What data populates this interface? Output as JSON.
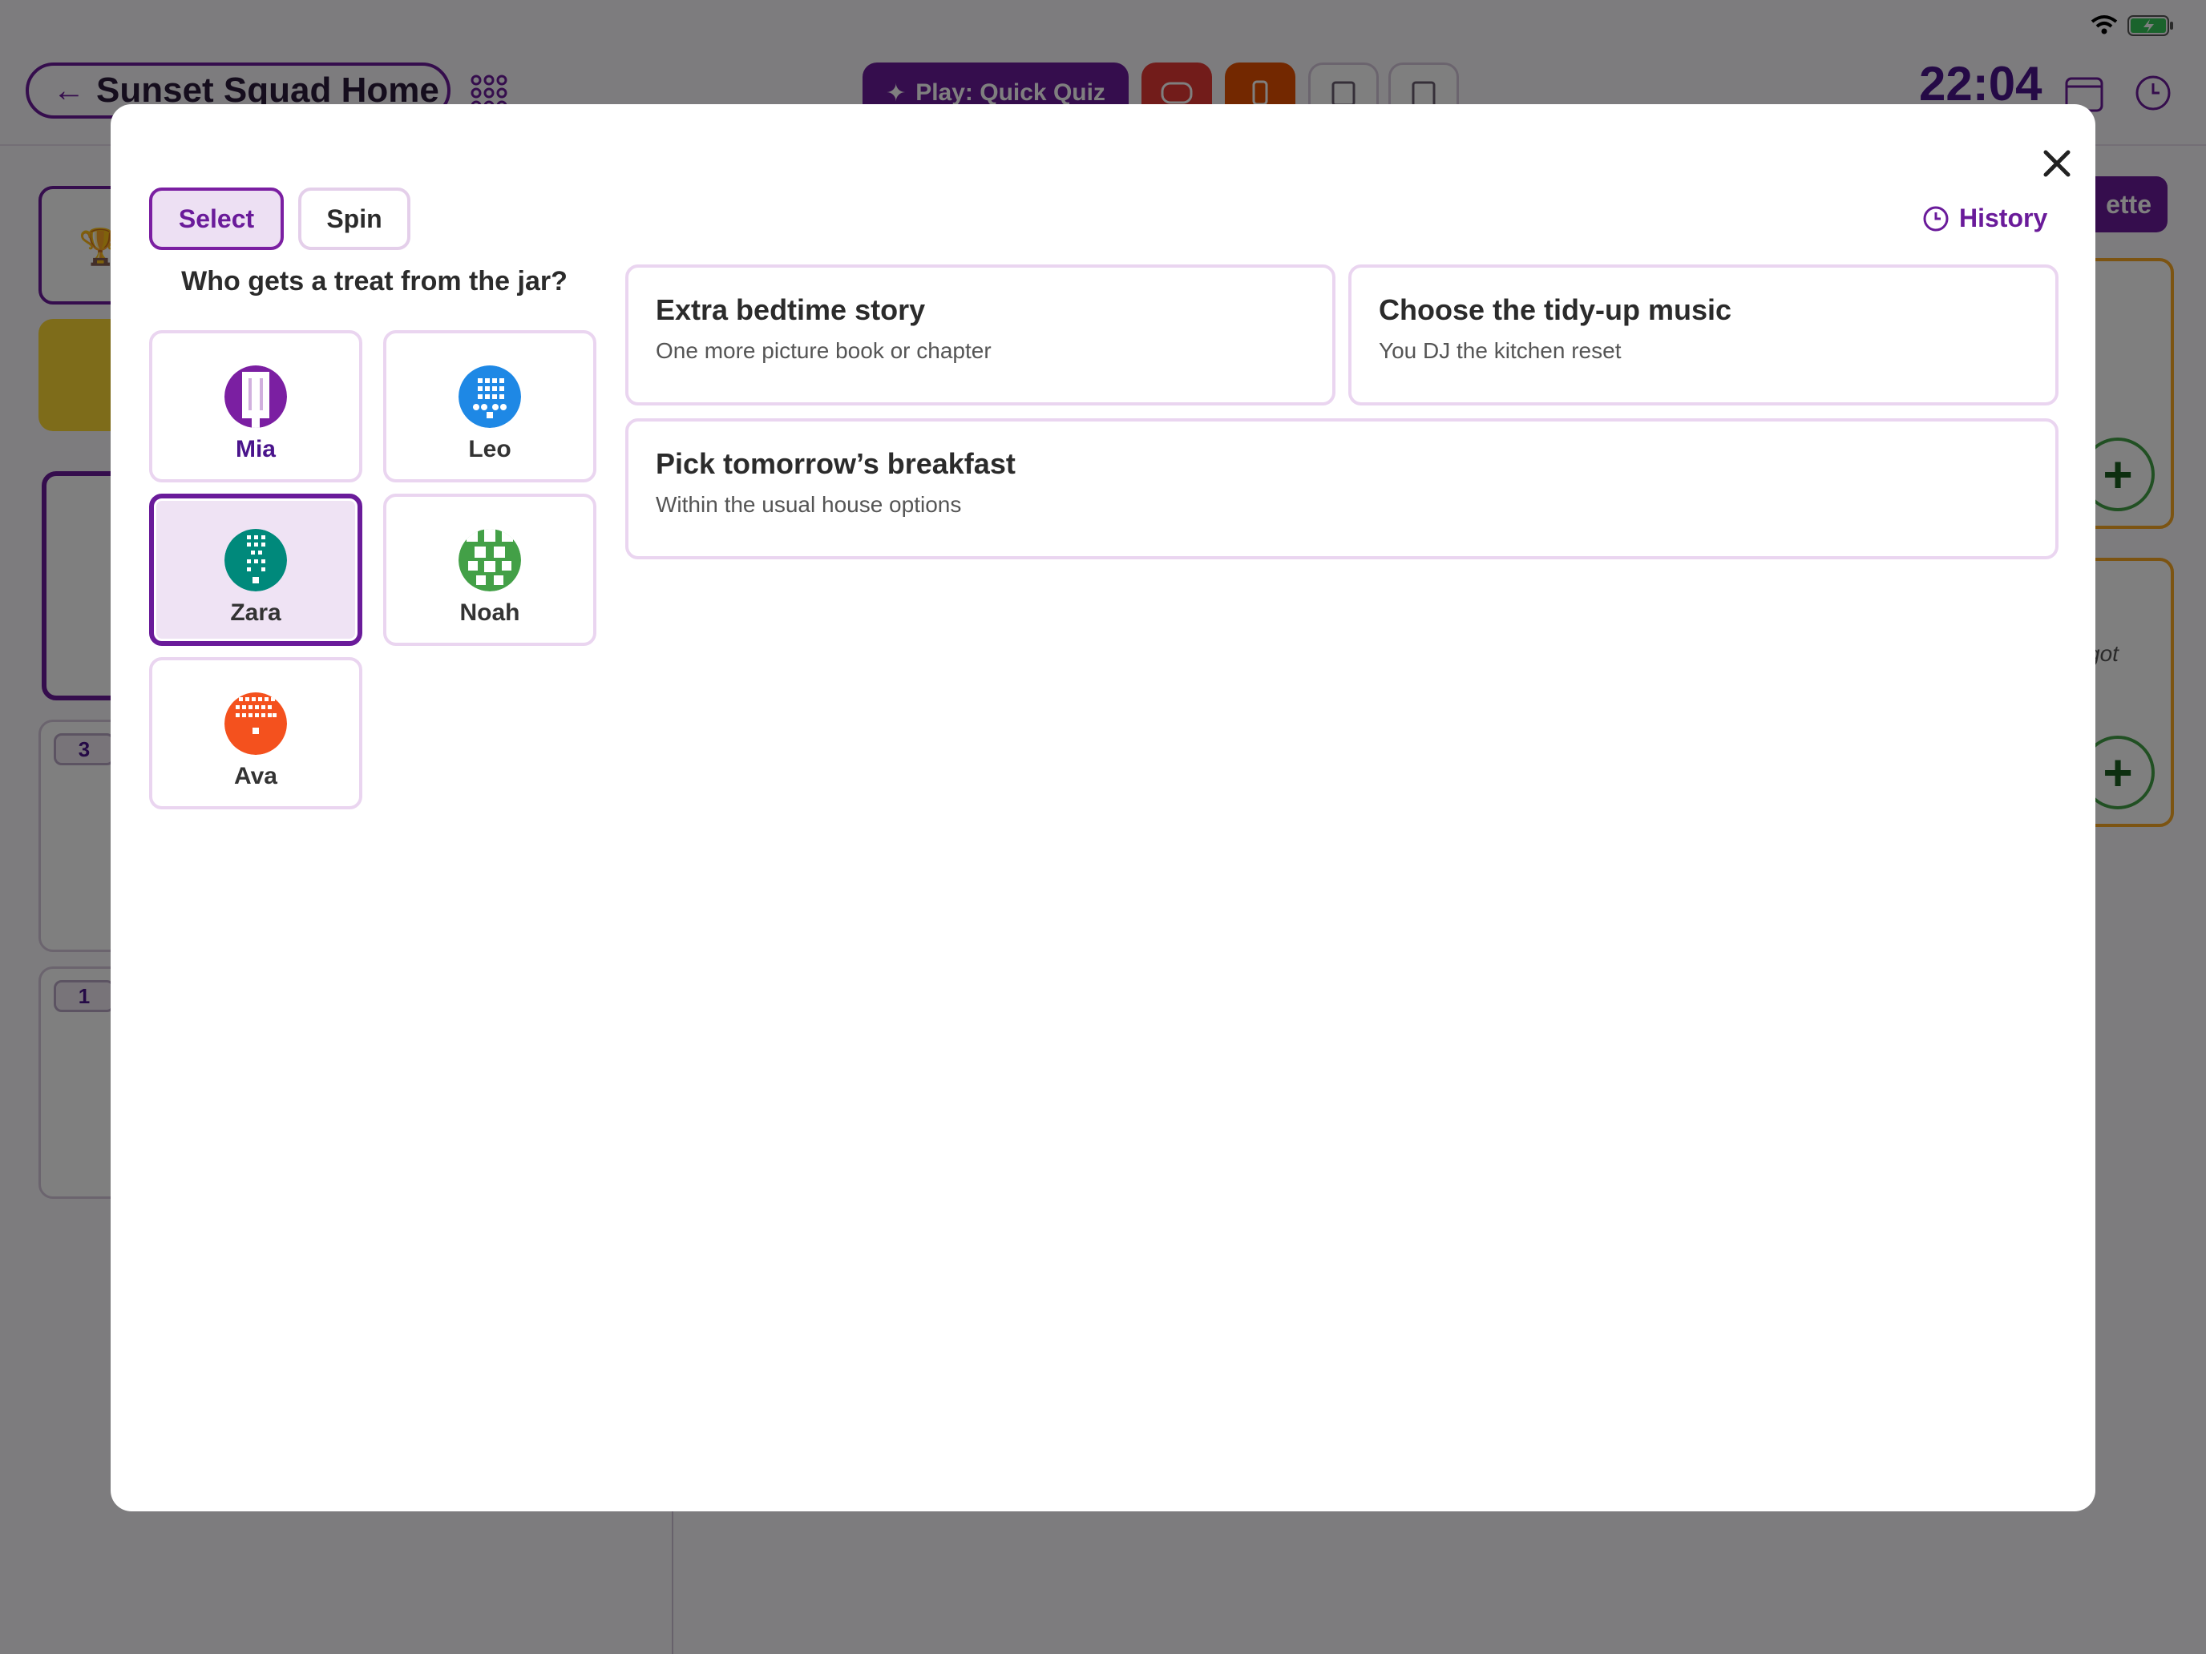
{
  "status_bar": {
    "icons": [
      "wifi-icon",
      "battery-charging-icon"
    ]
  },
  "header": {
    "back_label": "Sunset Squad Home",
    "quiz_button_label": "Play: Quick Quiz",
    "time": "22:04"
  },
  "background": {
    "badges": [
      "3",
      "1"
    ],
    "right_button_label": "ette",
    "right_card_text": "got"
  },
  "modal": {
    "modes": [
      "Select",
      "Spin"
    ],
    "active_mode": "Select",
    "history_label": "History",
    "question": "Who gets a treat from the jar?",
    "people": [
      {
        "name": "Mia",
        "color": "#7b1fa2",
        "selected": false
      },
      {
        "name": "Leo",
        "color": "#1e88e5",
        "selected": false
      },
      {
        "name": "Zara",
        "color": "#00897b",
        "selected": true
      },
      {
        "name": "Noah",
        "color": "#43a047",
        "selected": false
      },
      {
        "name": "Ava",
        "color": "#f4511e",
        "selected": false
      }
    ],
    "rewards": [
      {
        "title": "Extra bedtime story",
        "subtitle": "One more picture book or chapter"
      },
      {
        "title": "Choose the tidy-up music",
        "subtitle": "You DJ the kitchen reset"
      },
      {
        "title": "Pick tomorrow’s breakfast",
        "subtitle": "Within the usual house options"
      }
    ]
  },
  "colors": {
    "accent": "#6a1b9a",
    "accent_light": "#ede0f3",
    "border": "#ead5f0"
  }
}
